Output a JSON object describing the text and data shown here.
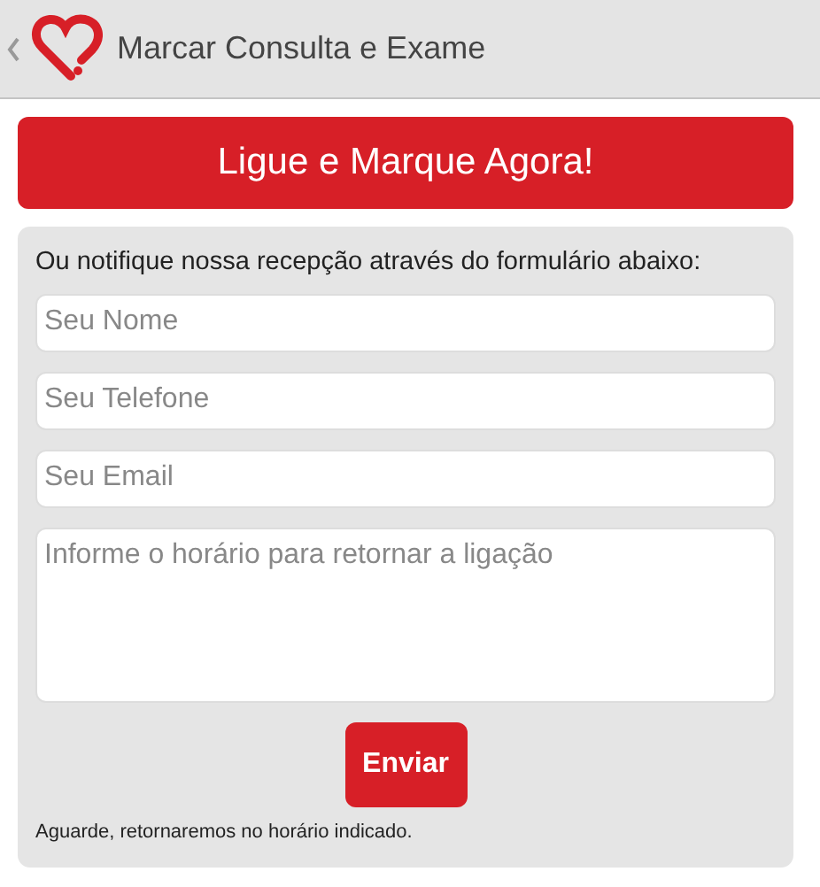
{
  "header": {
    "title": "Marcar Consulta e Exame"
  },
  "call_button": {
    "label": "Ligue e Marque Agora!"
  },
  "form": {
    "intro": "Ou notifique nossa recepção através do formulário abaixo:",
    "fields": [
      {
        "kind": "input",
        "placeholder": "Seu Nome"
      },
      {
        "kind": "input",
        "placeholder": "Seu Telefone"
      },
      {
        "kind": "input",
        "placeholder": "Seu Email"
      },
      {
        "kind": "textarea",
        "placeholder": "Informe o horário para retornar a ligação"
      }
    ],
    "submit": "Enviar",
    "note": "Aguarde, retornaremos no horário indicado."
  }
}
